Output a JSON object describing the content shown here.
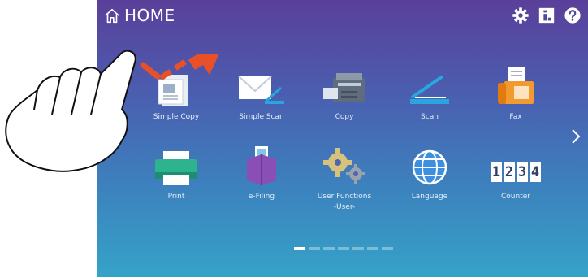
{
  "header": {
    "title": "HOME",
    "home_icon": "home-icon",
    "settings_icon": "gear-icon",
    "info_icon": "info-icon",
    "help_icon": "help-icon"
  },
  "apps": [
    {
      "label": "Simple Copy",
      "icon": "simple-copy-icon"
    },
    {
      "label": "Simple Scan",
      "icon": "simple-scan-icon"
    },
    {
      "label": "Copy",
      "icon": "copy-icon"
    },
    {
      "label": "Scan",
      "icon": "scan-icon"
    },
    {
      "label": "Fax",
      "icon": "fax-icon"
    },
    {
      "label": "Print",
      "icon": "print-icon"
    },
    {
      "label": "e-Filing",
      "icon": "e-filing-icon"
    },
    {
      "label": "User Functions\n-User-",
      "icon": "user-functions-icon"
    },
    {
      "label": "Language",
      "icon": "globe-icon"
    },
    {
      "label": "Counter",
      "icon": "counter-icon"
    }
  ],
  "counter_digits": "1234",
  "pager": {
    "pages": 7,
    "current": 1
  },
  "next_icon": "chevron-right-icon",
  "gesture": {
    "hand_icon": "pointing-hand-icon",
    "arrow_icon": "swipe-arrow-icon"
  },
  "colors": {
    "arrow": "#e8502a",
    "scan_blue": "#29a6e0",
    "print_green": "#2db38e"
  }
}
